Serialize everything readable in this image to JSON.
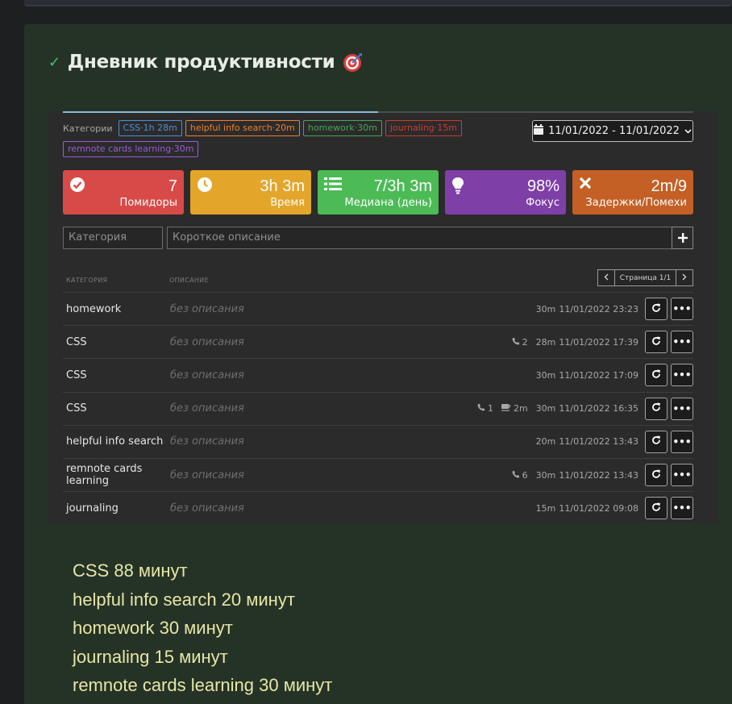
{
  "header": {
    "title": "Дневник продуктивности",
    "check_icon": "check-icon",
    "emoji_icon": "target-icon"
  },
  "progress": {
    "value": 0.5,
    "color": "#8ab9d8"
  },
  "categories": {
    "label": "Категории",
    "tags": [
      {
        "text": "CSS·1h 28m",
        "color": "#4f8fd0"
      },
      {
        "text": "helpful info search·20m",
        "color": "#ee7f2d"
      },
      {
        "text": "homework·30m",
        "color": "#45a852"
      },
      {
        "text": "journaling·15m",
        "color": "#d2392f"
      },
      {
        "text": "remnote cards learning·30m",
        "color": "#9b5bd2"
      }
    ]
  },
  "date_range": {
    "value": "11/01/2022 - 11/01/2022",
    "icon": "calendar-icon"
  },
  "cards": [
    {
      "value": "7",
      "label": "Помидоры",
      "icon": "check-circle-icon",
      "color": "#d84a47"
    },
    {
      "value": "3h 3m",
      "label": "Время",
      "icon": "clock-icon",
      "color": "#e3a52a"
    },
    {
      "value": "7/3h 3m",
      "label": "Медиана (день)",
      "icon": "list-icon",
      "color": "#4cbb56"
    },
    {
      "value": "98%",
      "label": "Фокус",
      "icon": "lightbulb-icon",
      "color": "#7e3fa7"
    },
    {
      "value": "2m/9",
      "label": "Задержки/Помехи",
      "icon": "times-icon",
      "color": "#c45f25"
    }
  ],
  "form": {
    "category_placeholder": "Категория",
    "description_placeholder": "Короткое описание",
    "add_icon": "plus-icon"
  },
  "table": {
    "col_category": "КАТЕГОРИЯ",
    "col_description": "ОПИСАНИЕ",
    "page_text": "Страница 1/1",
    "rows": [
      {
        "category": "homework",
        "description": "без описания",
        "calls": "",
        "breaks": "",
        "duration": "30m",
        "datetime": "11/01/2022 23:23"
      },
      {
        "category": "CSS",
        "description": "без описания",
        "calls": "2",
        "breaks": "",
        "duration": "28m",
        "datetime": "11/01/2022 17:39"
      },
      {
        "category": "CSS",
        "description": "без описания",
        "calls": "",
        "breaks": "",
        "duration": "30m",
        "datetime": "11/01/2022 17:09"
      },
      {
        "category": "CSS",
        "description": "без описания",
        "calls": "1",
        "breaks": "2m",
        "duration": "30m",
        "datetime": "11/01/2022 16:35"
      },
      {
        "category": "helpful info search",
        "description": "без описания",
        "calls": "",
        "breaks": "",
        "duration": "20m",
        "datetime": "11/01/2022 13:43"
      },
      {
        "category": "remnote cards learning",
        "description": "без описания",
        "calls": "6",
        "breaks": "",
        "duration": "30m",
        "datetime": "11/01/2022 13:43"
      },
      {
        "category": "journaling",
        "description": "без описания",
        "calls": "",
        "breaks": "",
        "duration": "15m",
        "datetime": "11/01/2022 09:08"
      }
    ]
  },
  "summary": [
    "CSS 88 минут",
    "helpful info search 20 минут",
    "homework 30 минут",
    "journaling 15 минут",
    "remnote cards learning 30 минут"
  ]
}
